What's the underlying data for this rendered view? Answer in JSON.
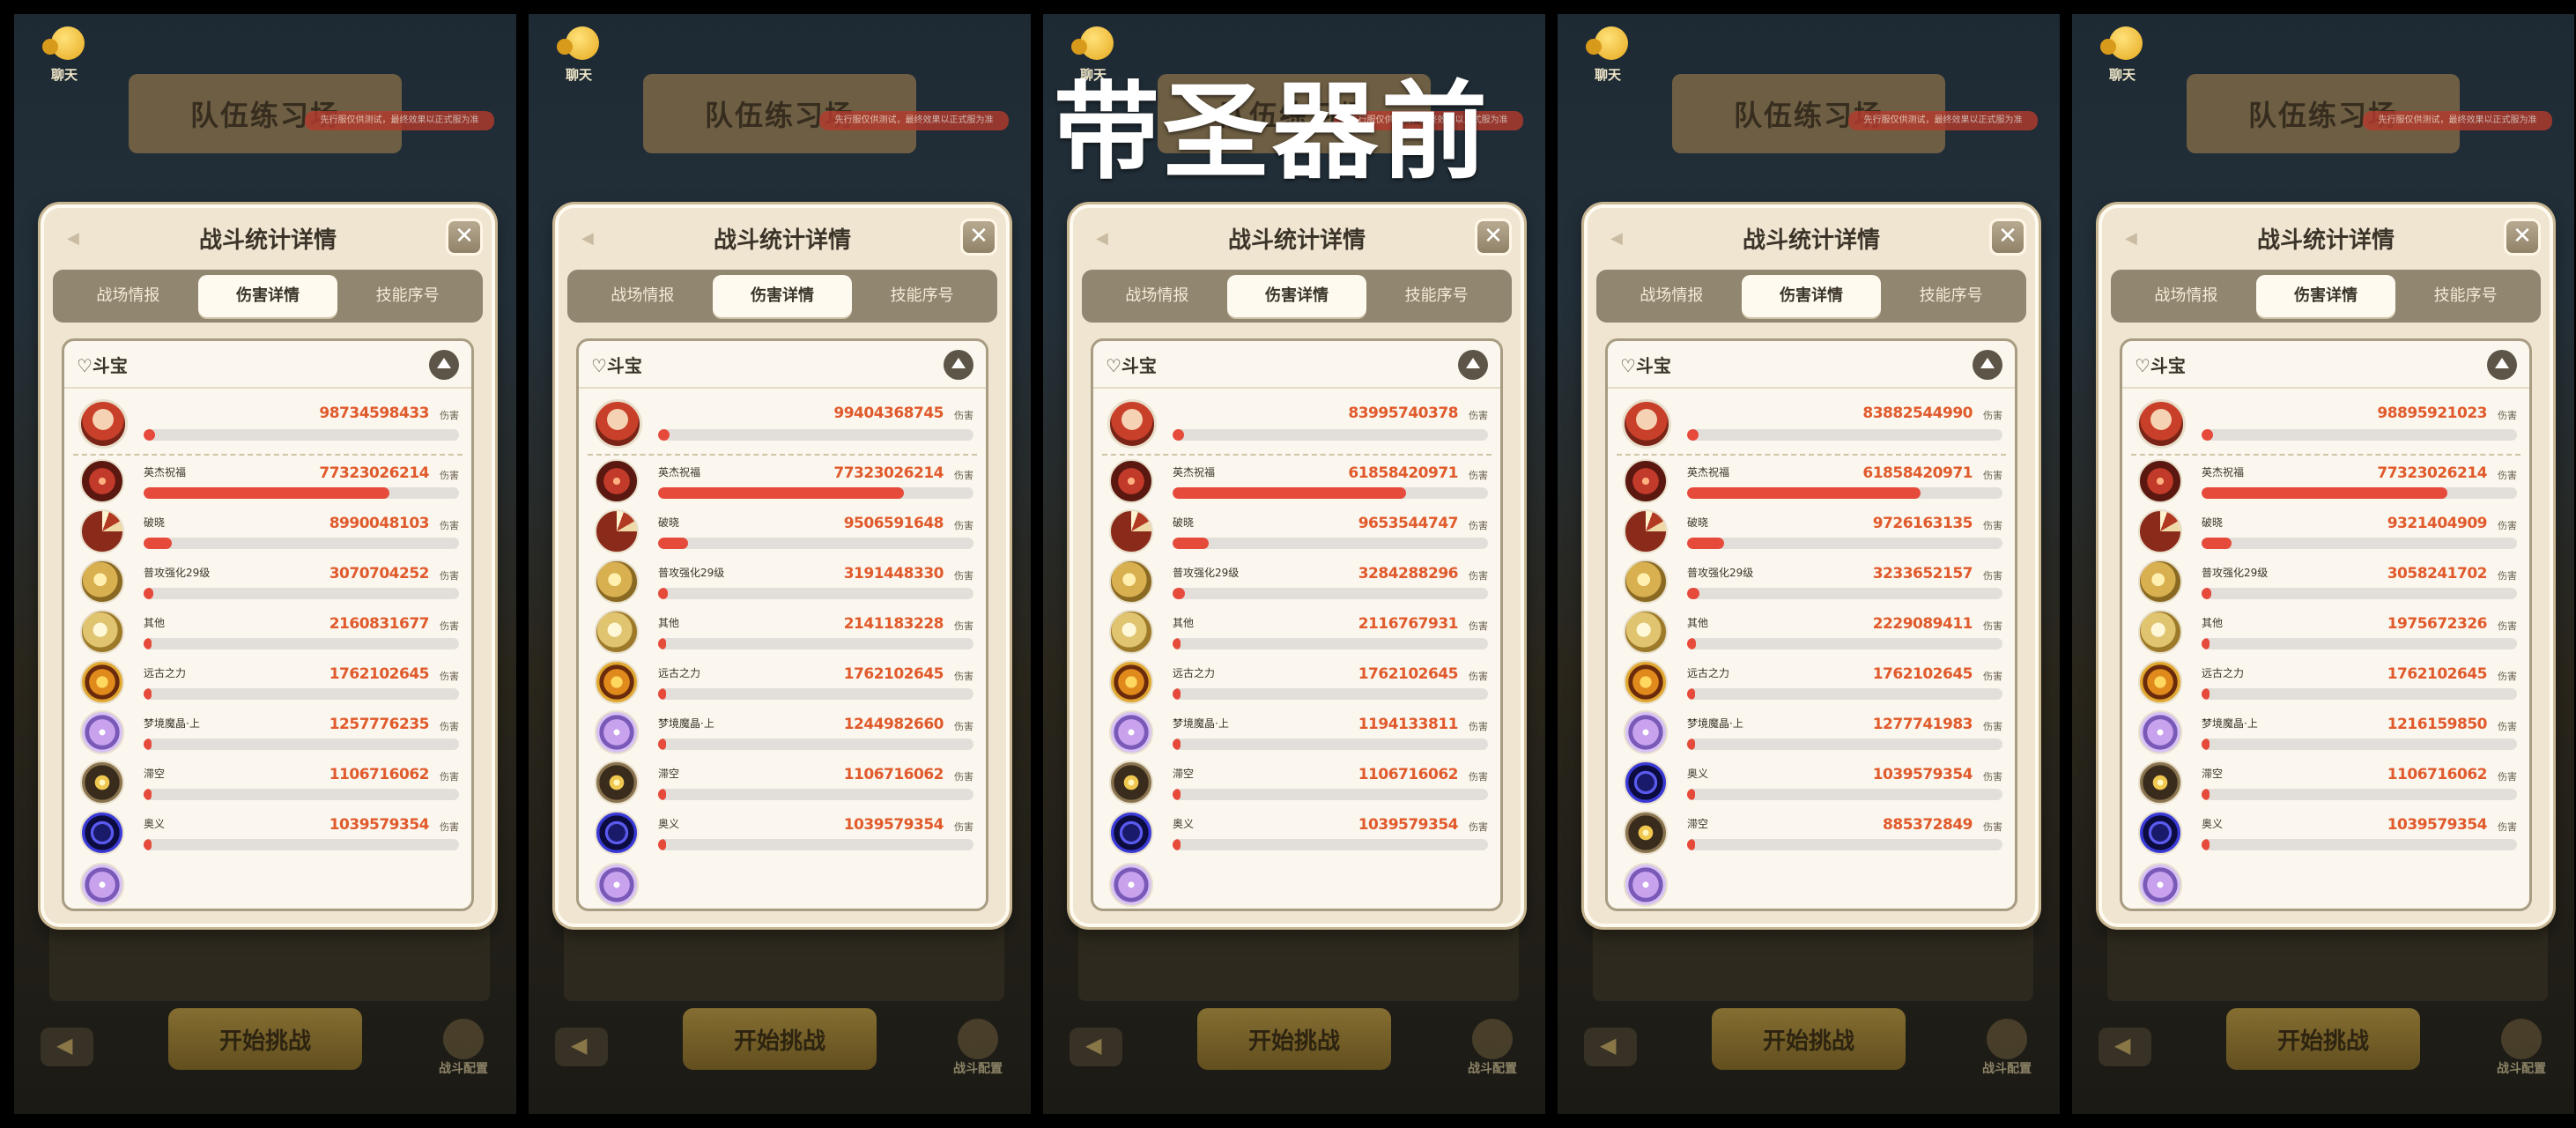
{
  "overlay_title": "带圣器前",
  "common": {
    "chat_label": "聊天",
    "banner": "队伍练习场",
    "test_note": "先行服仅供测试，最终效果以正式服为准",
    "dialog_title": "战斗统计详情",
    "close": "✕",
    "tabs": [
      "战场情报",
      "伤害详情",
      "技能序号"
    ],
    "team_name": "♡斗宝",
    "unit": "伤害",
    "start_button": "开始挑战",
    "team_config": "战斗配置"
  },
  "screens": [
    {
      "total": "98734598433",
      "skills": [
        {
          "name": "英杰祝福",
          "value": "77323026214",
          "icon": "ic-hero-bless",
          "pct": 0.78
        },
        {
          "name": "破晓",
          "value": "8990048103",
          "icon": "ic-break",
          "pct": 0.09
        },
        {
          "name": "普攻强化29级",
          "value": "3070704252",
          "icon": "ic-normal",
          "pct": 0.03
        },
        {
          "name": "其他",
          "value": "2160831677",
          "icon": "ic-other",
          "pct": 0.022
        },
        {
          "name": "远古之力",
          "value": "1762102645",
          "icon": "ic-ancient",
          "pct": 0.018
        },
        {
          "name": "梦境魔晶·上",
          "value": "1257776235",
          "icon": "ic-dream",
          "pct": 0.013
        },
        {
          "name": "滞空",
          "value": "1106716062",
          "icon": "ic-void",
          "pct": 0.011
        },
        {
          "name": "奥义",
          "value": "1039579354",
          "icon": "ic-mystery",
          "pct": 0.01
        }
      ]
    },
    {
      "total": "99404368745",
      "skills": [
        {
          "name": "英杰祝福",
          "value": "77323026214",
          "icon": "ic-hero-bless",
          "pct": 0.78
        },
        {
          "name": "破晓",
          "value": "9506591648",
          "icon": "ic-break",
          "pct": 0.096
        },
        {
          "name": "普攻强化29级",
          "value": "3191448330",
          "icon": "ic-normal",
          "pct": 0.032
        },
        {
          "name": "其他",
          "value": "2141183228",
          "icon": "ic-other",
          "pct": 0.021
        },
        {
          "name": "远古之力",
          "value": "1762102645",
          "icon": "ic-ancient",
          "pct": 0.018
        },
        {
          "name": "梦境魔晶·上",
          "value": "1244982660",
          "icon": "ic-dream",
          "pct": 0.013
        },
        {
          "name": "滞空",
          "value": "1106716062",
          "icon": "ic-void",
          "pct": 0.011
        },
        {
          "name": "奥义",
          "value": "1039579354",
          "icon": "ic-mystery",
          "pct": 0.01
        }
      ]
    },
    {
      "total": "83995740378",
      "skills": [
        {
          "name": "英杰祝福",
          "value": "61858420971",
          "icon": "ic-hero-bless",
          "pct": 0.74
        },
        {
          "name": "破晓",
          "value": "9653544747",
          "icon": "ic-break",
          "pct": 0.115
        },
        {
          "name": "普攻强化29级",
          "value": "3284288296",
          "icon": "ic-normal",
          "pct": 0.039
        },
        {
          "name": "其他",
          "value": "2116767931",
          "icon": "ic-other",
          "pct": 0.025
        },
        {
          "name": "远古之力",
          "value": "1762102645",
          "icon": "ic-ancient",
          "pct": 0.021
        },
        {
          "name": "梦境魔晶·上",
          "value": "1194133811",
          "icon": "ic-dream",
          "pct": 0.014
        },
        {
          "name": "滞空",
          "value": "1106716062",
          "icon": "ic-void",
          "pct": 0.013
        },
        {
          "name": "奥义",
          "value": "1039579354",
          "icon": "ic-mystery",
          "pct": 0.012
        }
      ]
    },
    {
      "total": "83882544990",
      "skills": [
        {
          "name": "英杰祝福",
          "value": "61858420971",
          "icon": "ic-hero-bless",
          "pct": 0.74
        },
        {
          "name": "破晓",
          "value": "9726163135",
          "icon": "ic-break",
          "pct": 0.116
        },
        {
          "name": "普攻强化29级",
          "value": "3233652157",
          "icon": "ic-normal",
          "pct": 0.039
        },
        {
          "name": "其他",
          "value": "2229089411",
          "icon": "ic-other",
          "pct": 0.027
        },
        {
          "name": "远古之力",
          "value": "1762102645",
          "icon": "ic-ancient",
          "pct": 0.021
        },
        {
          "name": "梦境魔晶·上",
          "value": "1277741983",
          "icon": "ic-dream",
          "pct": 0.015
        },
        {
          "name": "奥义",
          "value": "1039579354",
          "icon": "ic-mystery",
          "pct": 0.012
        },
        {
          "name": "滞空",
          "value": "885372849",
          "icon": "ic-void",
          "pct": 0.011
        }
      ]
    },
    {
      "total": "98895921023",
      "skills": [
        {
          "name": "英杰祝福",
          "value": "77323026214",
          "icon": "ic-hero-bless",
          "pct": 0.78
        },
        {
          "name": "破晓",
          "value": "9321404909",
          "icon": "ic-break",
          "pct": 0.094
        },
        {
          "name": "普攻强化29级",
          "value": "3058241702",
          "icon": "ic-normal",
          "pct": 0.031
        },
        {
          "name": "其他",
          "value": "1975672326",
          "icon": "ic-other",
          "pct": 0.02
        },
        {
          "name": "远古之力",
          "value": "1762102645",
          "icon": "ic-ancient",
          "pct": 0.018
        },
        {
          "name": "梦境魔晶·上",
          "value": "1216159850",
          "icon": "ic-dream",
          "pct": 0.012
        },
        {
          "name": "滞空",
          "value": "1106716062",
          "icon": "ic-void",
          "pct": 0.011
        },
        {
          "name": "奥义",
          "value": "1039579354",
          "icon": "ic-mystery",
          "pct": 0.01
        }
      ]
    }
  ]
}
